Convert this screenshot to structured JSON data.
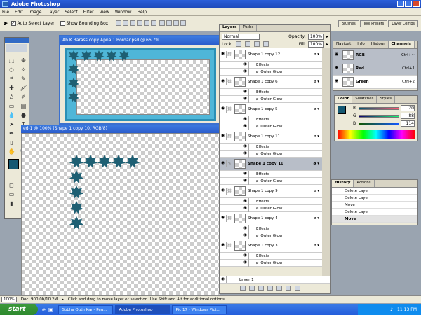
{
  "app": {
    "title": "Adobe Photoshop"
  },
  "menu": [
    "File",
    "Edit",
    "Image",
    "Layer",
    "Select",
    "Filter",
    "View",
    "Window",
    "Help"
  ],
  "options": {
    "auto_select": "Auto Select Layer",
    "bounding_box": "Show Bounding Box",
    "auto_select_checked": true,
    "bounding_box_checked": false
  },
  "well_tabs": [
    "Brushes",
    "Tool Presets",
    "Layer Comps"
  ],
  "doc1": {
    "title": "Ab K Barass copy Apna 1 Bordar.psd @ 66.7% ..."
  },
  "doc2": {
    "title": "ed-1 @ 100% (Shape 1 copy 10, RGB/8)"
  },
  "layers_panel": {
    "tabs": [
      "Layers",
      "Paths"
    ],
    "blend": "Normal",
    "opacity_label": "Opacity:",
    "opacity": "100%",
    "lock_label": "Lock:",
    "fill_label": "Fill:",
    "fill": "100%",
    "effects_label": "Effects",
    "glow_label": "Outer Glow",
    "layers": [
      {
        "name": "Shape 1 copy 12",
        "selected": false
      },
      {
        "name": "Shape 1 copy 6",
        "selected": false
      },
      {
        "name": "Shape 1 copy 5",
        "selected": false
      },
      {
        "name": "Shape 1 copy 11",
        "selected": false
      },
      {
        "name": "Shape 1 copy 10",
        "selected": true
      },
      {
        "name": "Shape 1 copy 9",
        "selected": false
      },
      {
        "name": "Shape 1 copy 4",
        "selected": false
      },
      {
        "name": "Shape 1 copy 3",
        "selected": false
      }
    ],
    "bottom_layer": "Layer 1"
  },
  "channels_panel": {
    "tabs": [
      "Navigat",
      "Info",
      "Histogr",
      "Channels"
    ],
    "rows": [
      {
        "name": "RGB",
        "key": "Ctrl+~"
      },
      {
        "name": "Red",
        "key": "Ctrl+1"
      },
      {
        "name": "Green",
        "key": "Ctrl+2"
      }
    ]
  },
  "color_panel": {
    "tabs": [
      "Color",
      "Swatches",
      "Styles"
    ],
    "r_label": "R",
    "g_label": "G",
    "b_label": "B",
    "r": "20",
    "g": "88",
    "b": "114",
    "fg_color": "#145872"
  },
  "history_panel": {
    "tabs": [
      "History",
      "Actions"
    ],
    "items": [
      "Delete Layer",
      "Delete Layer",
      "Move",
      "Delete Layer",
      "Move"
    ]
  },
  "status": {
    "zoom": "100%",
    "doc": "Doc: 900.0K/10.2M",
    "hint": "Click and drag to move layer or selection.  Use Shift and Alt for additional options."
  },
  "taskbar": {
    "start": "start",
    "tasks": [
      "Sobha Outh Kar - Peg...",
      "Adobe Photoshop",
      "Pic 17 - Windows Pict..."
    ],
    "active": 1,
    "clock": "11:13 PM"
  }
}
